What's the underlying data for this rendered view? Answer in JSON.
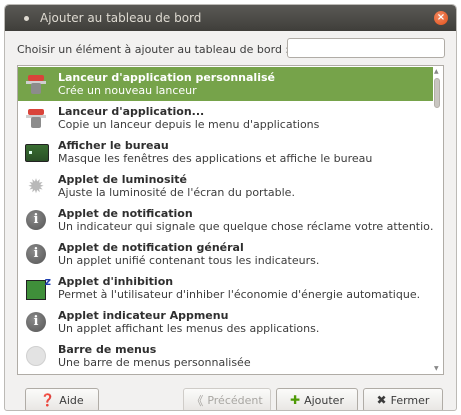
{
  "window": {
    "title": "Ajouter au tableau de bord"
  },
  "prompt": {
    "label": "Choisir un élément à ajouter au tableau de bord :",
    "search_value": "",
    "search_placeholder": ""
  },
  "items": [
    {
      "icon": "launcher-icon",
      "title": "Lanceur d'application personnalisé",
      "desc": "Crée un nouveau lanceur",
      "selected": true
    },
    {
      "icon": "launcher-icon",
      "title": "Lanceur d'application...",
      "desc": "Copie un lanceur depuis le menu d'applications",
      "selected": false
    },
    {
      "icon": "desktop-icon",
      "title": "Afficher le bureau",
      "desc": "Masque les fenêtres des applications et affiche le bureau",
      "selected": false
    },
    {
      "icon": "brightness-icon",
      "title": "Applet de luminosité",
      "desc": "Ajuste la luminosité de l'écran du portable.",
      "selected": false
    },
    {
      "icon": "info-icon",
      "title": "Applet de notification",
      "desc": "Un indicateur qui signale que quelque chose réclame votre attentio…",
      "selected": false
    },
    {
      "icon": "info-icon",
      "title": "Applet de notification général",
      "desc": "Un applet unifié contenant tous les indicateurs.",
      "selected": false
    },
    {
      "icon": "inhibit-icon",
      "title": "Applet d'inhibition",
      "desc": "Permet à l'utilisateur d'inhiber l'économie d'énergie automatique.",
      "selected": false
    },
    {
      "icon": "info-icon",
      "title": "Applet indicateur Appmenu",
      "desc": "Un applet affichant les menus des applications.",
      "selected": false
    },
    {
      "icon": "menu-bar-icon",
      "title": "Barre de menus",
      "desc": "Une barre de menus personnalisée",
      "selected": false
    }
  ],
  "buttons": {
    "help": "Aide",
    "back": "Précédent",
    "add": "Ajouter",
    "close": "Fermer"
  },
  "colors": {
    "selection": "#76a34a",
    "titlebar": "#3f3e3a",
    "close": "#e25019"
  }
}
